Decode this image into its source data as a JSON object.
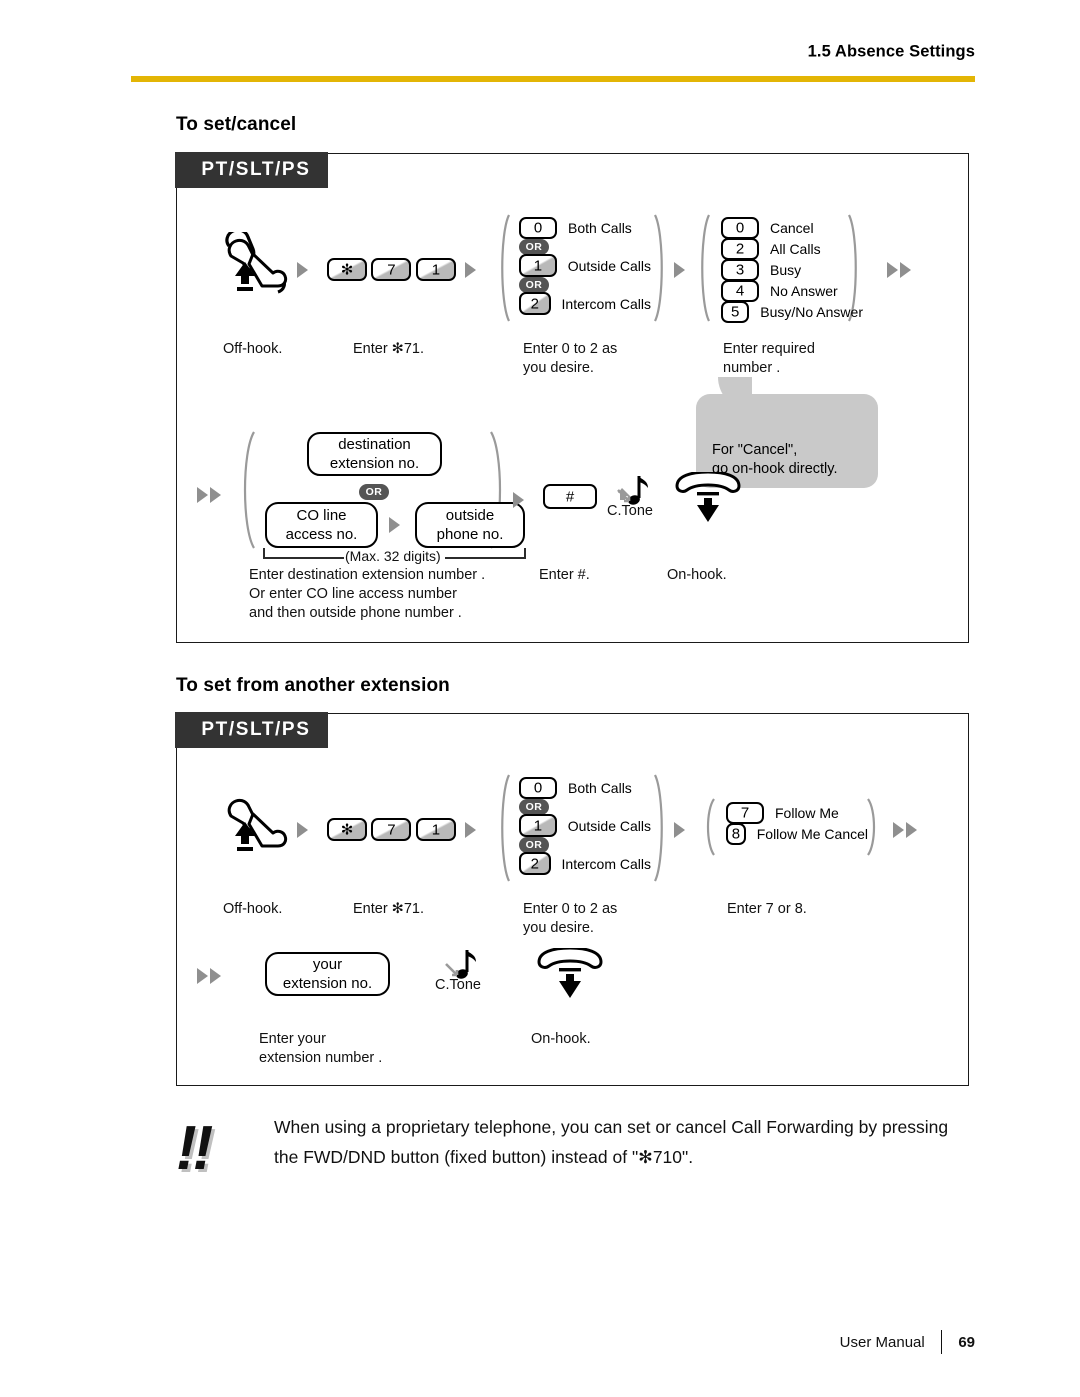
{
  "header": {
    "section_label": "1.5 Absence Settings",
    "rule_color": "#e3b505"
  },
  "sections": [
    {
      "title": "To set/cancel",
      "tab_label": "PT/SLT/PS",
      "steps": {
        "offhook_caption": "Off-hook.",
        "dial_keys": [
          "✻",
          "7",
          "1"
        ],
        "dial_caption": "Enter ✻71.",
        "call_type_options": [
          {
            "key": "0",
            "label": "Both Calls"
          },
          {
            "or": "OR"
          },
          {
            "key": "1",
            "label": "Outside Calls"
          },
          {
            "or": "OR"
          },
          {
            "key": "2",
            "label": "Intercom Calls"
          }
        ],
        "call_type_caption": "Enter 0 to 2 as\nyou desire.",
        "fwd_type_options": [
          {
            "key": "0",
            "label": "Cancel"
          },
          {
            "key": "2",
            "label": "All Calls"
          },
          {
            "key": "3",
            "label": "Busy"
          },
          {
            "key": "4",
            "label": "No Answer"
          },
          {
            "key": "5",
            "label": "Busy/No Answer"
          }
        ],
        "fwd_type_caption": "Enter required\nnumber .",
        "bubble_text": "For \"Cancel\",\ngo on-hook directly.",
        "dest_box": "destination\nextension no.",
        "or_label": "OR",
        "co_line_box": "CO line\naccess no.",
        "outside_box": "outside\nphone no.",
        "max_digits": "(Max. 32 digits)",
        "hash_key": "#",
        "tone_label": "C.Tone",
        "dest_caption": "Enter destination extension number  .\nOr enter CO line access number\nand then outside phone number   .",
        "hash_caption": "Enter #.",
        "onhook_caption": "On-hook."
      }
    },
    {
      "title": "To set from another extension",
      "tab_label": "PT/SLT/PS",
      "steps": {
        "offhook_caption": "Off-hook.",
        "dial_keys": [
          "✻",
          "7",
          "1"
        ],
        "dial_caption": "Enter ✻71.",
        "call_type_options": [
          {
            "key": "0",
            "label": "Both Calls"
          },
          {
            "or": "OR"
          },
          {
            "key": "1",
            "label": "Outside Calls"
          },
          {
            "or": "OR"
          },
          {
            "key": "2",
            "label": "Intercom Calls"
          }
        ],
        "call_type_caption": "Enter 0 to 2 as\nyou desire.",
        "follow_me_options": [
          {
            "key": "7",
            "label": "Follow Me"
          },
          {
            "key": "8",
            "label": "Follow Me Cancel"
          }
        ],
        "follow_me_caption": "Enter 7 or 8.",
        "ext_box": "your\nextension no.",
        "tone_label": "C.Tone",
        "ext_caption": "Enter your\nextension number  .",
        "onhook_caption": "On-hook."
      }
    }
  ],
  "note": {
    "mark": "!!",
    "text": "When using a proprietary telephone, you can set or cancel Call Forwarding by pressing\nthe FWD/DND button (fixed button) instead of \"✻710\"."
  },
  "footer": {
    "manual_label": "User Manual",
    "page_number": "69"
  }
}
